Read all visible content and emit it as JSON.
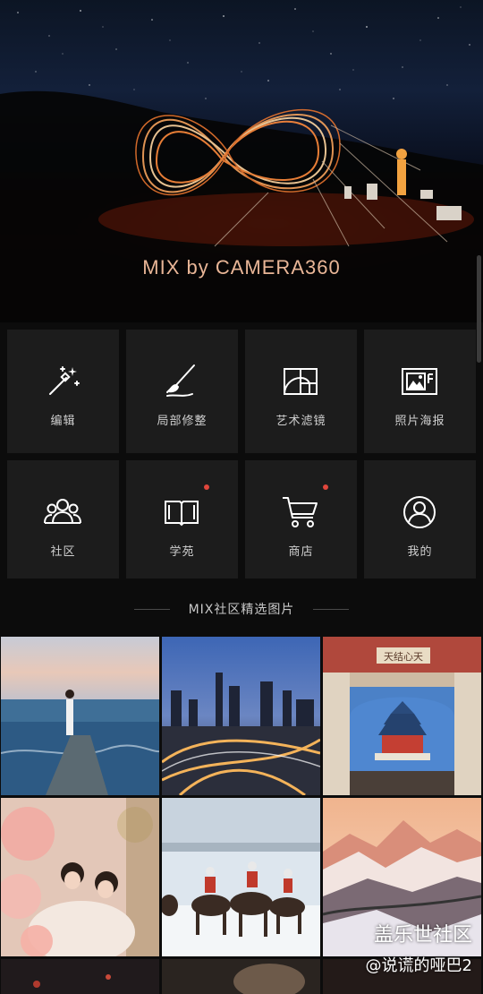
{
  "hero": {
    "title": "MIX by CAMERA360"
  },
  "tools": [
    {
      "label": "编辑",
      "icon": "magic-wand-icon",
      "badge": false
    },
    {
      "label": "局部修整",
      "icon": "brush-icon",
      "badge": false
    },
    {
      "label": "艺术滤镜",
      "icon": "golden-ratio-icon",
      "badge": false
    },
    {
      "label": "照片海报",
      "icon": "poster-icon",
      "badge": false
    },
    {
      "label": "社区",
      "icon": "community-icon",
      "badge": false
    },
    {
      "label": "学苑",
      "icon": "book-icon",
      "badge": true
    },
    {
      "label": "商店",
      "icon": "cart-icon",
      "badge": true
    },
    {
      "label": "我的",
      "icon": "user-icon",
      "badge": false
    }
  ],
  "section": {
    "title": "MIX社区精选图片"
  },
  "photos": [
    {
      "subject": "woman on pier by the sea"
    },
    {
      "subject": "city highway interchange at dusk"
    },
    {
      "subject": "temple of heaven through gate"
    },
    {
      "subject": "couple among flowers"
    },
    {
      "subject": "horse riders in snow"
    },
    {
      "subject": "snowy mountains at sunset"
    }
  ],
  "photo_gate_sign": "天结心天",
  "watermark": {
    "line1": "盖乐世社区",
    "line2": "@说谎的哑巴2"
  },
  "colors": {
    "accent_badge": "#e0463c",
    "hero_title": "#e9b697",
    "tile_bg": "#1c1c1c"
  }
}
